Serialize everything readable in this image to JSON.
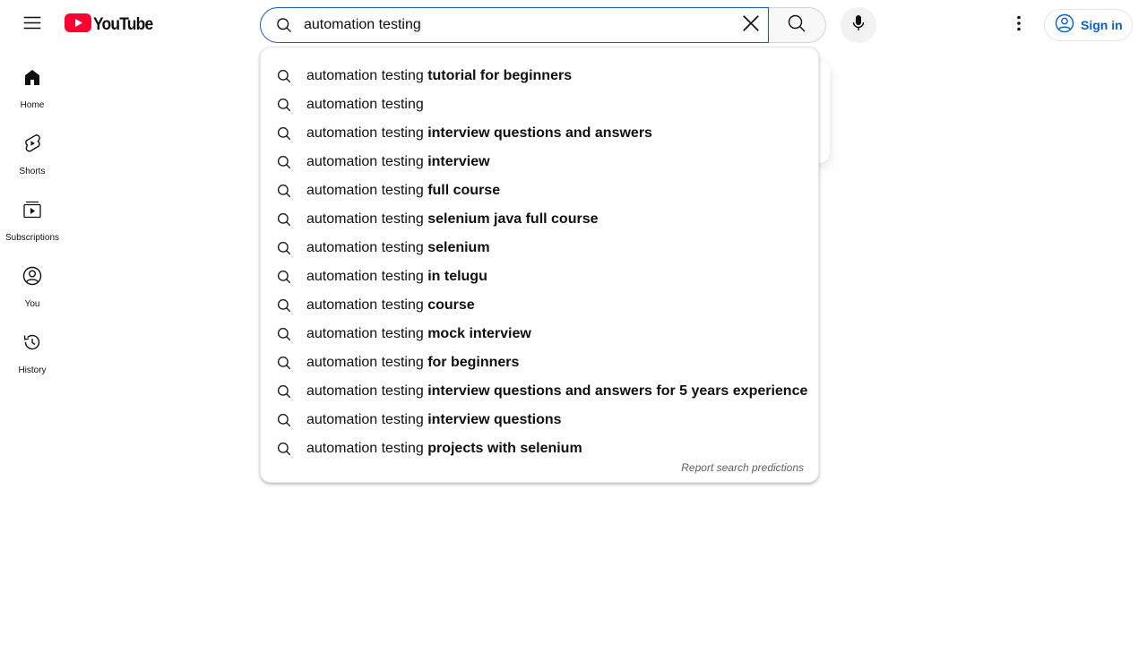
{
  "header": {
    "logo_text": "YouTube",
    "search": {
      "value": "automation testing",
      "placeholder": "Search"
    },
    "signin_label": "Sign in"
  },
  "sidebar": {
    "items": [
      {
        "label": "Home",
        "icon": "home-icon"
      },
      {
        "label": "Shorts",
        "icon": "shorts-icon"
      },
      {
        "label": "Subscriptions",
        "icon": "subscriptions-icon"
      },
      {
        "label": "You",
        "icon": "you-icon"
      },
      {
        "label": "History",
        "icon": "history-icon"
      }
    ]
  },
  "suggestions": {
    "query": "automation testing",
    "items": [
      {
        "prefix": "automation testing",
        "completion": " tutorial for beginners"
      },
      {
        "prefix": "automation testing",
        "completion": ""
      },
      {
        "prefix": "automation testing",
        "completion": " interview questions and answers"
      },
      {
        "prefix": "automation testing",
        "completion": " interview"
      },
      {
        "prefix": "automation testing",
        "completion": " full course"
      },
      {
        "prefix": "automation testing",
        "completion": " selenium java full course"
      },
      {
        "prefix": "automation testing",
        "completion": " selenium"
      },
      {
        "prefix": "automation testing",
        "completion": " in telugu"
      },
      {
        "prefix": "automation testing",
        "completion": " course"
      },
      {
        "prefix": "automation testing",
        "completion": " mock interview"
      },
      {
        "prefix": "automation testing",
        "completion": " for beginners"
      },
      {
        "prefix": "automation testing",
        "completion": " interview questions and answers for 5 years experience"
      },
      {
        "prefix": "automation testing",
        "completion": " interview questions"
      },
      {
        "prefix": "automation testing",
        "completion": " projects with selenium"
      }
    ],
    "report_label": "Report search predictions"
  },
  "colors": {
    "brand_red": "#ff0033",
    "link_blue": "#065fd4",
    "focus_blue": "#1c62b9"
  }
}
